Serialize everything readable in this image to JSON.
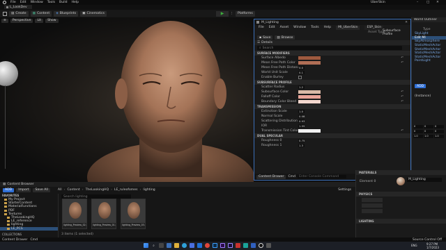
{
  "app": {
    "menu": [
      "File",
      "Edit",
      "Window",
      "Tools",
      "Build",
      "Help"
    ],
    "level_tab": "L_LookDev",
    "material_tab": "M_Lighting",
    "window_title": "UberSkin",
    "colors": {
      "accent": "#2f6fd6",
      "play": "#3cae3c",
      "selection": "#2c4f78"
    }
  },
  "toolbar": {
    "create": "Create",
    "content": "Content",
    "blueprints": "Blueprints",
    "cinematics": "Cinematics",
    "platforms": "Platforms"
  },
  "viewport": {
    "perspective": "Perspective",
    "lit": "Lit",
    "show": "Show"
  },
  "editor": {
    "menu": [
      "File",
      "Edit",
      "Asset",
      "Window",
      "Tools",
      "Help"
    ],
    "tabs": [
      "MI_UberSkin",
      "ESP_Skin"
    ],
    "toolbar": [
      "Save",
      "Browse"
    ],
    "parent_label": "Asset Type",
    "parent_value": "Subsurface Profile",
    "details_tab": "Details",
    "search_placeholder": "Search",
    "sections": [
      {
        "title": "SURFACE MODIFIERS",
        "rows": [
          {
            "label": "Surface Albedo",
            "kind": "color",
            "color": "#9e5a3f"
          },
          {
            "label": "Mean Free Path Color",
            "kind": "color",
            "color": "#b06e55"
          },
          {
            "label": "Mean Free Path Distance",
            "kind": "value",
            "value": "0.0"
          },
          {
            "label": "World Unit Scale",
            "kind": "value",
            "value": "0.1"
          },
          {
            "label": "Enable Burley",
            "kind": "check"
          }
        ]
      },
      {
        "title": "SUBSURFACE PROFILE",
        "rows": [
          {
            "label": "Scatter Radius",
            "kind": "value",
            "value": "1.2"
          },
          {
            "label": "Subsurface Color",
            "kind": "color",
            "color": "#d9b9a6"
          },
          {
            "label": "Falloff Color",
            "kind": "color",
            "color": "#e8a397"
          },
          {
            "label": "Boundary Color Bleed",
            "kind": "color",
            "color": "#f4d8cf"
          }
        ]
      },
      {
        "title": "TRANSMISSION",
        "rows": [
          {
            "label": "Extinction Scale",
            "kind": "value",
            "value": "1.0"
          },
          {
            "label": "Normal Scale",
            "kind": "value",
            "value": "0.08"
          },
          {
            "label": "Scattering Distribution",
            "kind": "value",
            "value": "0.93"
          },
          {
            "label": "IOR",
            "kind": "value",
            "value": "1.55"
          },
          {
            "label": "Transmission Tint Color",
            "kind": "color",
            "color": "#f2f2f2"
          }
        ]
      },
      {
        "title": "DUAL SPECULAR",
        "rows": [
          {
            "label": "Roughness 0",
            "kind": "value",
            "value": "0.75"
          },
          {
            "label": "Roughness 1",
            "kind": "value",
            "value": "1.3"
          }
        ]
      }
    ],
    "bottom": {
      "content_drawer": "Content Drawer",
      "cmd": "Cmd",
      "console_placeholder": "Enter Console Command",
      "source_control": "Source Control Off"
    }
  },
  "outliner": {
    "title": "World Outliner",
    "type_header": "Type",
    "items": [
      "SkyLight",
      "Edit MI",
      "SkyAtmosphere",
      "StaticMeshActor",
      "StaticMeshActor",
      "StaticMeshActor",
      "StaticMeshActor",
      "PointLight"
    ],
    "add": "ADD",
    "component": "(Instance)",
    "transform": [
      [
        "0",
        "0",
        "0"
      ],
      [
        "0",
        "0",
        "0"
      ],
      [
        "1.0",
        "1.0",
        "1.0"
      ]
    ]
  },
  "content_browser": {
    "tab": "Content Browser",
    "add": "ADD",
    "import": "Import",
    "save_all": "Save All",
    "path": [
      "All",
      "Content",
      "TheLookingHQ",
      "LE_ruleofomes",
      "lighting"
    ],
    "settings": "Settings",
    "folders_title": "FAVORITES",
    "folders": [
      "My Project",
      "StarterContent",
      "MaterialFunctions",
      "PDF",
      "Textures",
      "TheLookingHQ",
      "LE_reference",
      "lighting",
      "LE_PCS"
    ],
    "search_placeholder": "Search lighting",
    "assets": [
      "lighting_Preview_02.uasset",
      "lighting_Preview_01.uasset",
      "lighting_Preview_03.uasset"
    ],
    "status": "3 items (1 selected)",
    "collections": "COLLECTIONS"
  },
  "details_panel": {
    "material_section": "MATERIALS",
    "element": "Element 0",
    "material_name": "M_Lighting",
    "physics": "PHYSICS",
    "lighting": "LIGHTING"
  },
  "status_bar": {
    "content_drawer": "Content Drawer",
    "cmd": "Cmd",
    "source_control": "Source Control Off"
  },
  "taskbar": {
    "time": "9:27 PM",
    "date": "1/7/2023",
    "lang": "ENG"
  }
}
